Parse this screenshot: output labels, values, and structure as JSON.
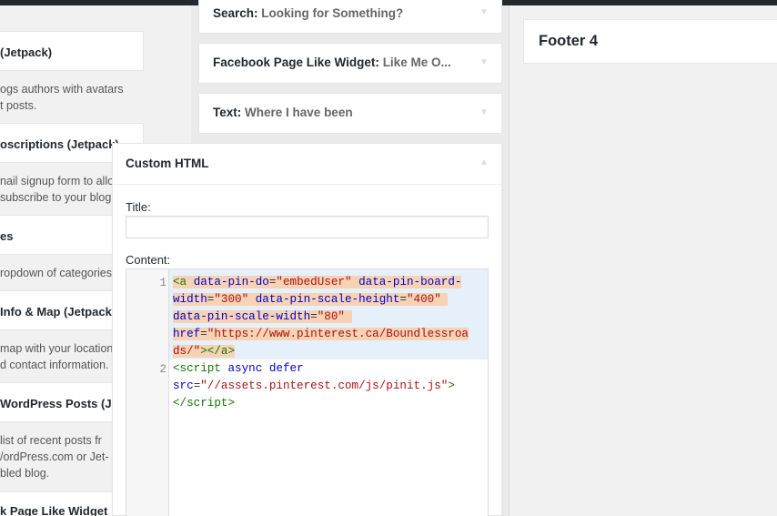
{
  "available_widgets": [
    {
      "title": "(Jetpack)",
      "desc": [
        "ogs authors with avatars",
        "t posts."
      ]
    },
    {
      "title": "oscriptions (Jetpack)",
      "desc": [
        "nail signup form to allo",
        "subscribe to your blog"
      ]
    },
    {
      "title": "es",
      "desc": [
        "ropdown of categories"
      ]
    },
    {
      "title": "Info & Map (Jetpack",
      "desc": [
        "map with your location",
        "d contact information."
      ]
    },
    {
      "title": "WordPress Posts (Je",
      "desc": [
        "list of recent posts fr",
        "/ordPress.com or Jet-",
        "bled blog."
      ]
    },
    {
      "title": "k Page Like Widget",
      "desc": []
    }
  ],
  "sidebar_widgets": [
    {
      "type": "Search:",
      "title": "Looking for Something?"
    },
    {
      "type": "Facebook Page Like Widget:",
      "title": "Like Me O..."
    },
    {
      "type": "Text:",
      "title": "Where I have been"
    }
  ],
  "custom_html": {
    "header": "Custom HTML",
    "title_label": "Title:",
    "title_value": "",
    "content_label": "Content:",
    "line_numbers": [
      "1",
      "2"
    ]
  },
  "footer": {
    "title": "Footer 4"
  },
  "icons": {
    "widget_toggle": "chevron-down-icon"
  },
  "colors": {
    "tag": "#117700",
    "attr": "#0000cc",
    "string": "#aa1111",
    "highlight": "#f6d3b5",
    "active_line": "#e6f0fb"
  }
}
